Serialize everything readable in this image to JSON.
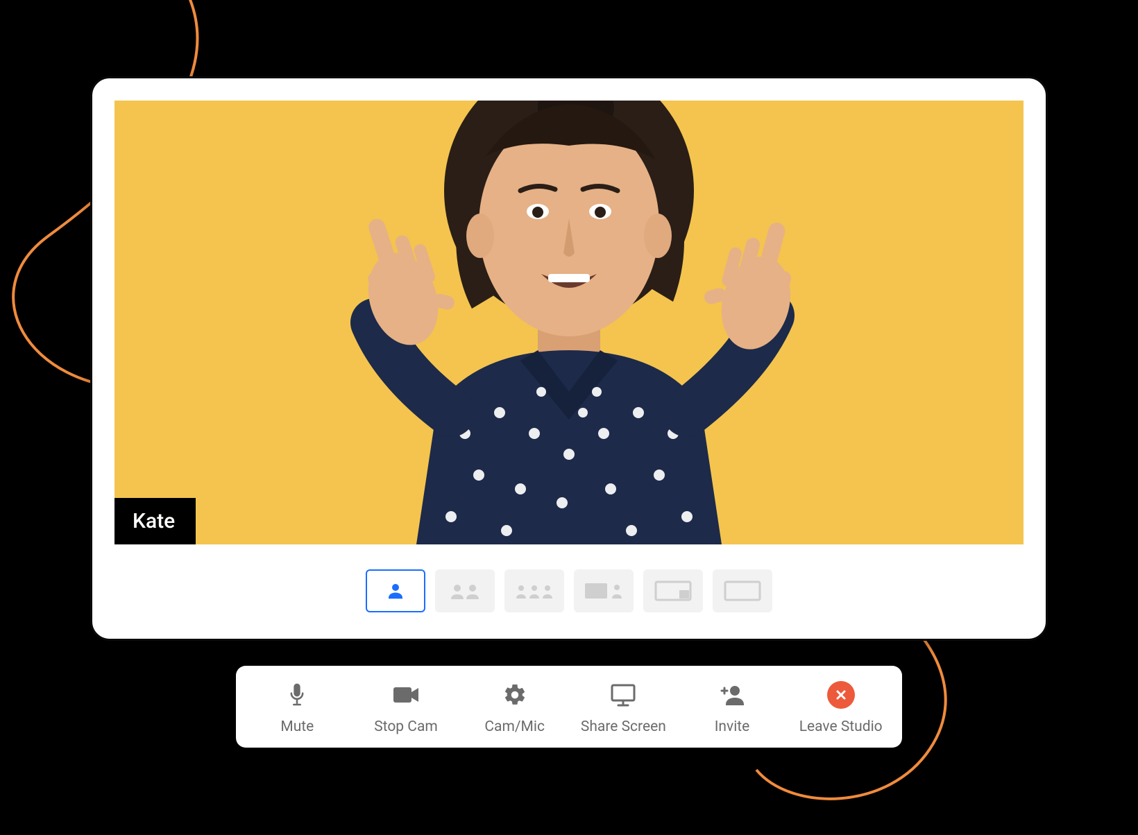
{
  "participant": {
    "name": "Kate"
  },
  "colors": {
    "video_bg": "#f4c44e",
    "accent": "#1a6dff",
    "leave": "#ec5a3b",
    "swirl": "#f08b3c"
  },
  "layouts": {
    "selected_index": 0,
    "options": [
      {
        "id": "single",
        "icon": "single-person"
      },
      {
        "id": "two-up",
        "icon": "two-person"
      },
      {
        "id": "three-up",
        "icon": "three-person"
      },
      {
        "id": "screen-person",
        "icon": "screen-plus-person"
      },
      {
        "id": "screen-small",
        "icon": "screen-corner"
      },
      {
        "id": "screen-full",
        "icon": "screen-full"
      }
    ]
  },
  "toolbar": {
    "items": [
      {
        "id": "mute",
        "label": "Mute",
        "icon": "microphone-icon"
      },
      {
        "id": "stop-cam",
        "label": "Stop Cam",
        "icon": "camera-icon"
      },
      {
        "id": "cam-mic",
        "label": "Cam/Mic",
        "icon": "gear-icon"
      },
      {
        "id": "share-screen",
        "label": "Share Screen",
        "icon": "monitor-icon"
      },
      {
        "id": "invite",
        "label": "Invite",
        "icon": "add-user-icon"
      },
      {
        "id": "leave",
        "label": "Leave Studio",
        "icon": "close-icon"
      }
    ]
  }
}
